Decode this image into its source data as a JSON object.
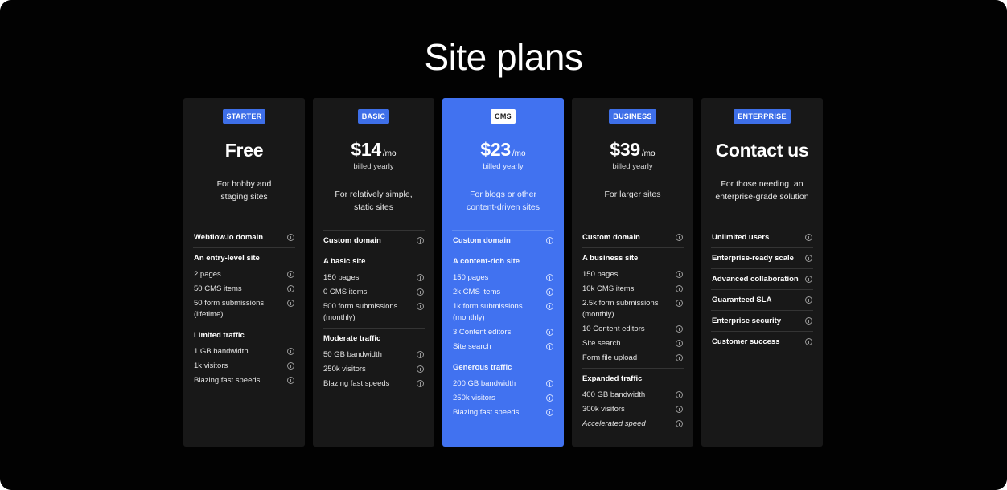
{
  "page": {
    "title": "Site plans"
  },
  "plans": [
    {
      "badge": "STARTER",
      "price": "Free",
      "per": "",
      "billed": "",
      "description_lines": [
        "For hobby and",
        "staging sites"
      ],
      "groups": [
        {
          "header": "Webflow.io domain",
          "items": []
        },
        {
          "header": "An entry-level site",
          "items": [
            "2 pages",
            "50 CMS items",
            "50 form submissions",
            "(lifetime)"
          ]
        },
        {
          "header": "Limited traffic",
          "items": [
            "1 GB bandwidth",
            "1k visitors",
            "Blazing fast speeds"
          ]
        }
      ]
    },
    {
      "badge": "BASIC",
      "price": "$14",
      "per": "/mo",
      "billed": "billed yearly",
      "description_lines": [
        "For relatively simple,",
        "static sites"
      ],
      "groups": [
        {
          "header": "Custom domain",
          "items": []
        },
        {
          "header": "A basic site",
          "items": [
            "150 pages",
            "0 CMS items",
            "500 form submissions",
            "(monthly)"
          ]
        },
        {
          "header": "Moderate traffic",
          "items": [
            "50 GB bandwidth",
            "250k visitors",
            "Blazing fast speeds"
          ]
        }
      ]
    },
    {
      "badge": "CMS",
      "price": "$23",
      "per": "/mo",
      "billed": "billed yearly",
      "description_lines": [
        "For blogs or other",
        "content-driven sites"
      ],
      "groups": [
        {
          "header": "Custom domain",
          "items": []
        },
        {
          "header": "A content-rich site",
          "items": [
            "150 pages",
            "2k CMS items",
            "1k form submissions",
            "(monthly)",
            "3 Content editors",
            "Site search"
          ]
        },
        {
          "header": "Generous traffic",
          "items": [
            "200 GB bandwidth",
            "250k visitors",
            "Blazing fast speeds"
          ]
        }
      ]
    },
    {
      "badge": "BUSINESS",
      "price": "$39",
      "per": "/mo",
      "billed": "billed yearly",
      "description_lines": [
        "For larger sites"
      ],
      "groups": [
        {
          "header": "Custom domain",
          "items": []
        },
        {
          "header": "A business site",
          "items": [
            "150 pages",
            "10k CMS items",
            "2.5k form submissions",
            "(monthly)",
            "10 Content editors",
            "Site search",
            "Form file upload"
          ]
        },
        {
          "header": "Expanded traffic",
          "items": [
            "400 GB bandwidth",
            "300k visitors",
            "Accelerated speed"
          ]
        }
      ]
    },
    {
      "badge": "ENTERPRISE",
      "price": "Contact us",
      "per": "",
      "billed": "",
      "description_lines": [
        "For those needing  an",
        "enterprise-grade solution"
      ],
      "rows": [
        "Unlimited users",
        "Enterprise-ready scale",
        "Advanced collaboration",
        "Guaranteed SLA",
        "Enterprise security",
        "Customer success"
      ]
    }
  ],
  "colors": {
    "background": "#020202",
    "card": "#181818",
    "featured_card": "#4172f0",
    "badge": "#3e6fe8"
  },
  "icons": {
    "feature_info": "info-icon"
  }
}
